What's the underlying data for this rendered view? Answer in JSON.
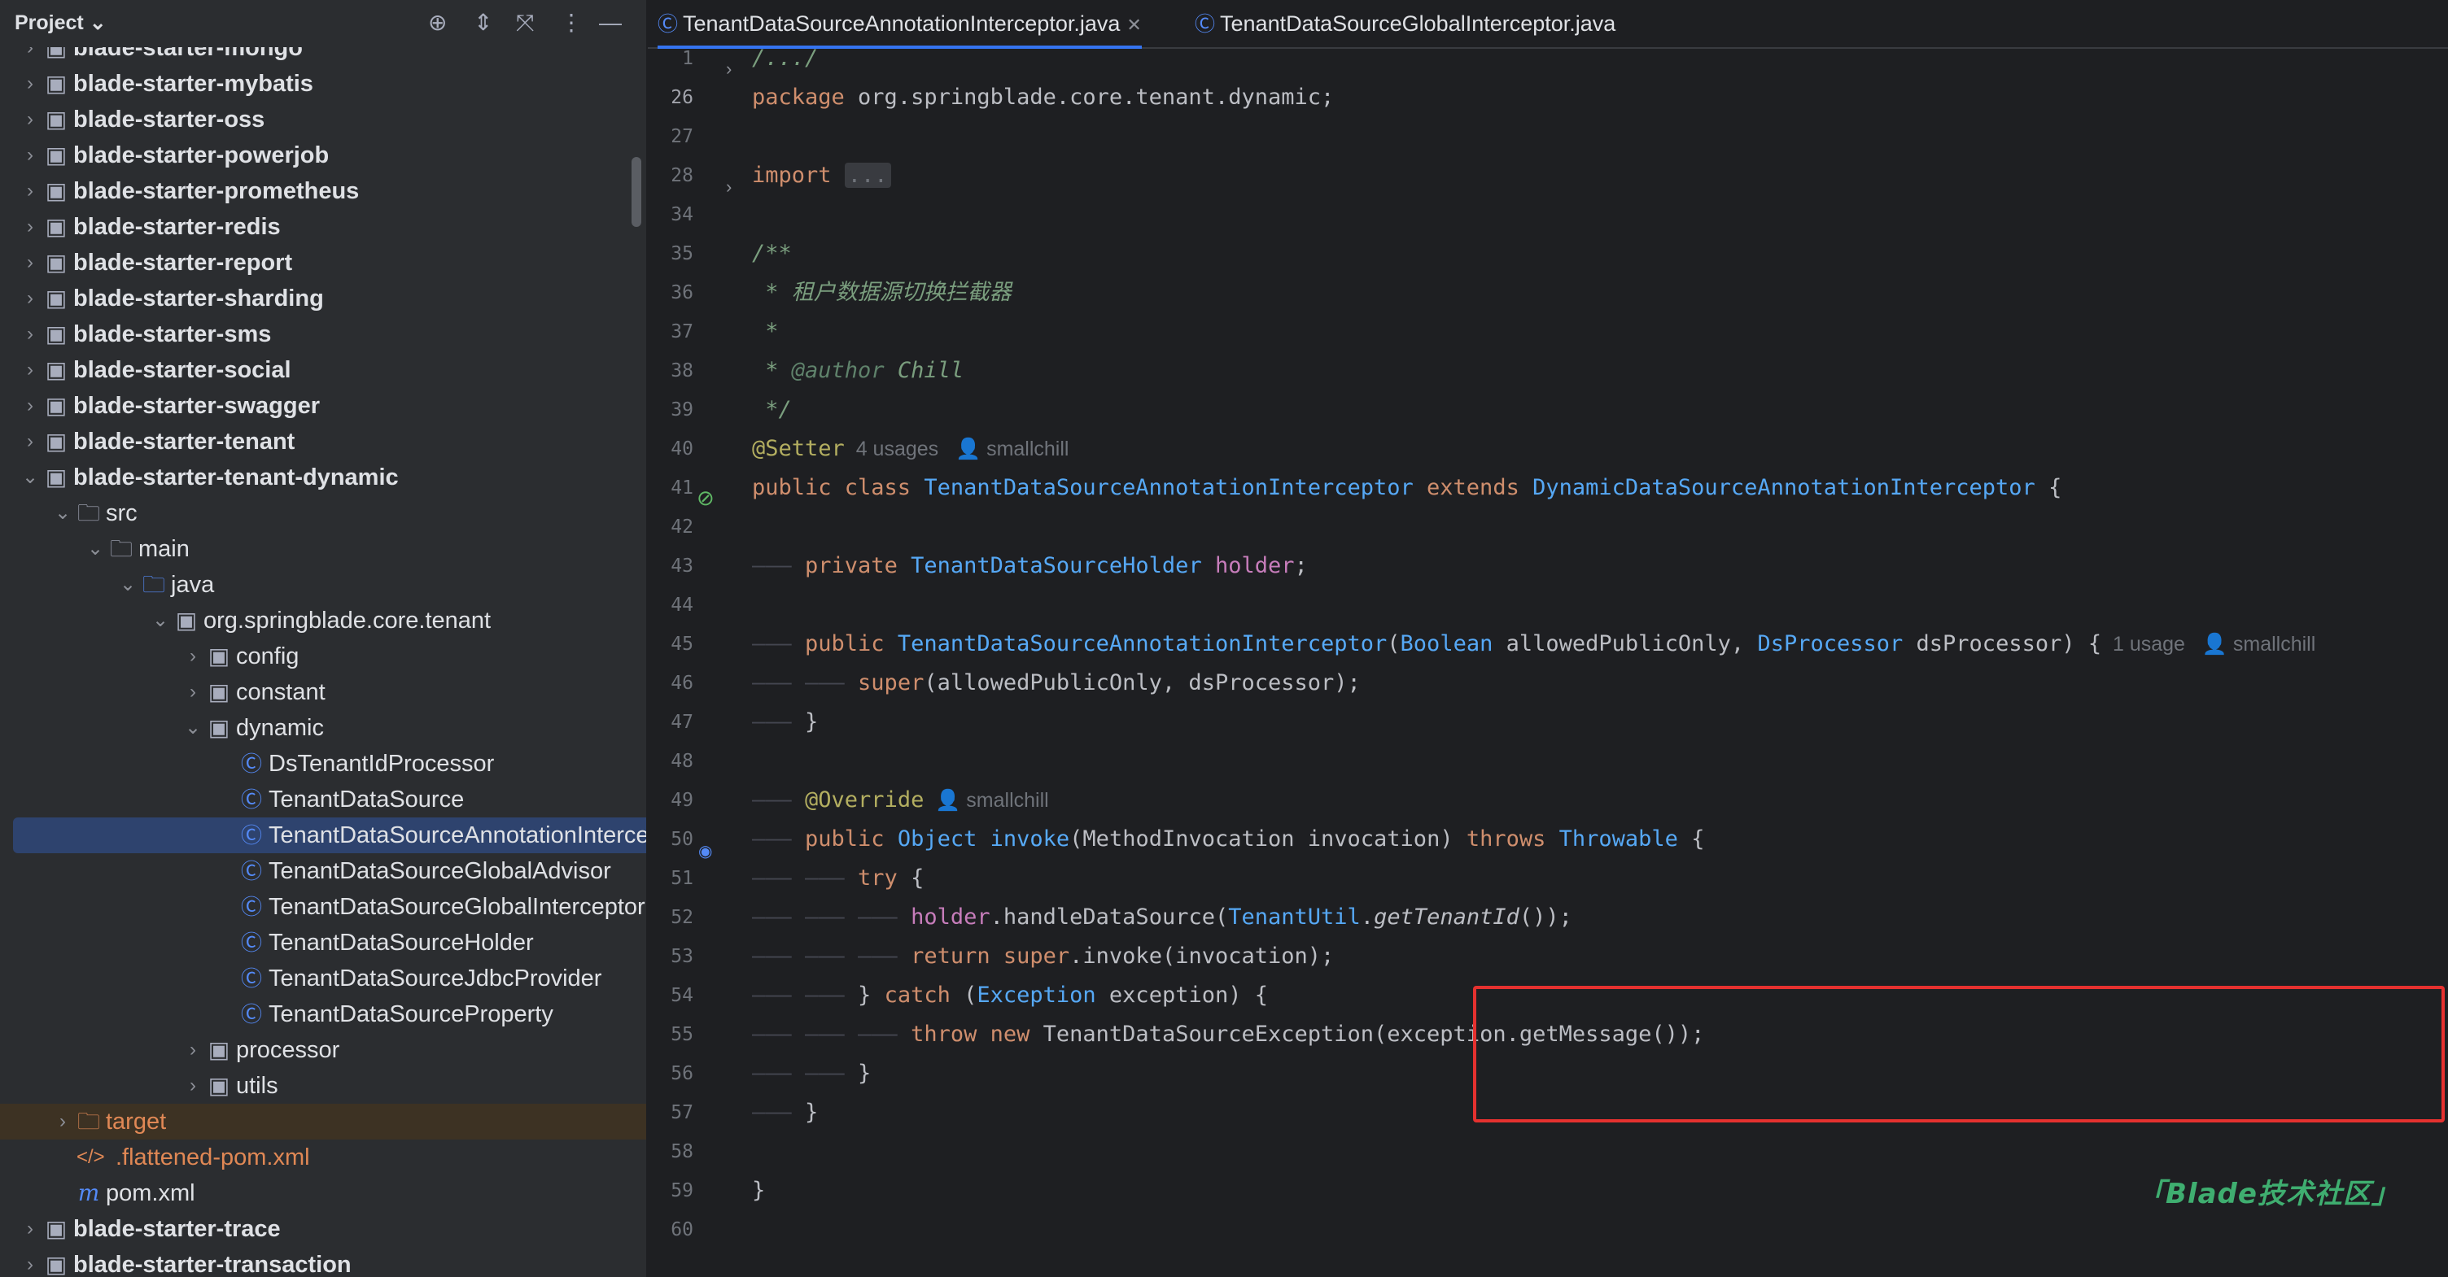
{
  "project_panel": {
    "title": "Project",
    "tree": [
      {
        "label": "blade-starter-mongo",
        "icon": "module-folder-icon",
        "kind": "module"
      },
      {
        "label": "blade-starter-mybatis",
        "icon": "module-folder-icon",
        "kind": "module"
      },
      {
        "label": "blade-starter-oss",
        "icon": "module-folder-icon",
        "kind": "module"
      },
      {
        "label": "blade-starter-powerjob",
        "icon": "module-folder-icon",
        "kind": "module"
      },
      {
        "label": "blade-starter-prometheus",
        "icon": "module-folder-icon",
        "kind": "module"
      },
      {
        "label": "blade-starter-redis",
        "icon": "module-folder-icon",
        "kind": "module"
      },
      {
        "label": "blade-starter-report",
        "icon": "module-folder-icon",
        "kind": "module"
      },
      {
        "label": "blade-starter-sharding",
        "icon": "module-folder-icon",
        "kind": "module"
      },
      {
        "label": "blade-starter-sms",
        "icon": "module-folder-icon",
        "kind": "module"
      },
      {
        "label": "blade-starter-social",
        "icon": "module-folder-icon",
        "kind": "module"
      },
      {
        "label": "blade-starter-swagger",
        "icon": "module-folder-icon",
        "kind": "module"
      },
      {
        "label": "blade-starter-tenant",
        "icon": "module-folder-icon",
        "kind": "module"
      },
      {
        "label": "blade-starter-tenant-dynamic",
        "icon": "module-folder-icon",
        "kind": "module",
        "expanded": true
      },
      {
        "label": "src",
        "icon": "folder-icon",
        "kind": "dir",
        "expanded": true
      },
      {
        "label": "main",
        "icon": "folder-icon",
        "kind": "dir",
        "expanded": true
      },
      {
        "label": "java",
        "icon": "source-folder-icon",
        "kind": "src",
        "expanded": true
      },
      {
        "label": "org.springblade.core.tenant",
        "icon": "package-icon",
        "kind": "pkg",
        "expanded": true
      },
      {
        "label": "config",
        "icon": "package-icon",
        "kind": "pkg"
      },
      {
        "label": "constant",
        "icon": "package-icon",
        "kind": "pkg"
      },
      {
        "label": "dynamic",
        "icon": "package-icon",
        "kind": "pkg",
        "expanded": true
      },
      {
        "label": "DsTenantIdProcessor",
        "icon": "class-icon",
        "kind": "cls"
      },
      {
        "label": "TenantDataSource",
        "icon": "class-icon",
        "kind": "cls"
      },
      {
        "label": "TenantDataSourceAnnotationInterceptor",
        "icon": "class-icon",
        "kind": "cls",
        "selected": true
      },
      {
        "label": "TenantDataSourceGlobalAdvisor",
        "icon": "class-icon",
        "kind": "cls"
      },
      {
        "label": "TenantDataSourceGlobalInterceptor",
        "icon": "class-icon",
        "kind": "cls"
      },
      {
        "label": "TenantDataSourceHolder",
        "icon": "class-icon",
        "kind": "cls"
      },
      {
        "label": "TenantDataSourceJdbcProvider",
        "icon": "class-icon",
        "kind": "cls"
      },
      {
        "label": "TenantDataSourceProperty",
        "icon": "class-icon",
        "kind": "cls"
      },
      {
        "label": "processor",
        "icon": "package-icon",
        "kind": "pkg"
      },
      {
        "label": "utils",
        "icon": "package-icon",
        "kind": "pkg"
      },
      {
        "label": "target",
        "icon": "folder-icon",
        "kind": "target"
      },
      {
        "label": ".flattened-pom.xml",
        "icon": "xml-file-icon",
        "kind": "xml"
      },
      {
        "label": "pom.xml",
        "icon": "maven-icon",
        "kind": "mvn"
      },
      {
        "label": "blade-starter-trace",
        "icon": "module-folder-icon",
        "kind": "module"
      },
      {
        "label": "blade-starter-transaction",
        "icon": "module-folder-icon",
        "kind": "module"
      }
    ]
  },
  "tabs": [
    {
      "label": "TenantDataSourceAnnotationInterceptor.java",
      "active": true
    },
    {
      "label": "TenantDataSourceGlobalInterceptor.java",
      "active": false
    }
  ],
  "editor": {
    "current_line": "26",
    "lines": [
      {
        "n": "1",
        "segs": [
          [
            "cm",
            "/.../"
          ]
        ]
      },
      {
        "n": "26",
        "segs": [
          [
            "kw",
            "package "
          ],
          [
            "",
            "org.springblade.core.tenant.dynamic;"
          ]
        ]
      },
      {
        "n": "27",
        "segs": []
      },
      {
        "n": "28",
        "segs": [
          [
            "kw",
            "import "
          ],
          [
            "fold",
            "..."
          ]
        ]
      },
      {
        "n": "34",
        "segs": []
      },
      {
        "n": "35",
        "segs": [
          [
            "cm",
            "/**"
          ]
        ]
      },
      {
        "n": "36",
        "segs": [
          [
            "cm",
            " * 租户数据源切换拦截器"
          ]
        ]
      },
      {
        "n": "37",
        "segs": [
          [
            "cm",
            " *"
          ]
        ]
      },
      {
        "n": "38",
        "segs": [
          [
            "cm",
            " * "
          ],
          [
            "cmc",
            "@author"
          ],
          [
            "cm",
            " Chill"
          ]
        ]
      },
      {
        "n": "39",
        "segs": [
          [
            "cm",
            " */"
          ]
        ]
      },
      {
        "n": "40",
        "segs": [
          [
            "ann",
            "@Setter"
          ],
          [
            "hint",
            "  4 usages   👤 smallchill"
          ]
        ]
      },
      {
        "n": "41",
        "segs": [
          [
            "kw",
            "public class "
          ],
          [
            "ty",
            "TenantDataSourceAnnotationInterceptor"
          ],
          [
            "kw",
            " extends "
          ],
          [
            "ty",
            "DynamicDataSourceAnnotationInterceptor"
          ],
          [
            "",
            " {"
          ]
        ]
      },
      {
        "n": "42",
        "segs": []
      },
      {
        "n": "43",
        "segs": [
          [
            "guide",
            "——— "
          ],
          [
            "kw",
            "private "
          ],
          [
            "ty",
            "TenantDataSourceHolder "
          ],
          [
            "fld",
            "holder"
          ],
          [
            "",
            ";"
          ]
        ]
      },
      {
        "n": "44",
        "segs": []
      },
      {
        "n": "45",
        "segs": [
          [
            "guide",
            "——— "
          ],
          [
            "kw",
            "public "
          ],
          [
            "mth",
            "TenantDataSourceAnnotationInterceptor"
          ],
          [
            "",
            "("
          ],
          [
            "ty",
            "Boolean "
          ],
          [
            "",
            "allowedPublicOnly, "
          ],
          [
            "ty",
            "DsProcessor "
          ],
          [
            "",
            "dsProcessor) {"
          ],
          [
            "hint",
            "  1 usage   👤 smallchill"
          ]
        ]
      },
      {
        "n": "46",
        "segs": [
          [
            "guide",
            "——— ——— "
          ],
          [
            "kw",
            "super"
          ],
          [
            "",
            "(allowedPublicOnly, dsProcessor);"
          ]
        ]
      },
      {
        "n": "47",
        "segs": [
          [
            "guide",
            "——— "
          ],
          [
            "",
            "}"
          ]
        ]
      },
      {
        "n": "48",
        "segs": []
      },
      {
        "n": "49",
        "segs": [
          [
            "guide",
            "——— "
          ],
          [
            "ann",
            "@Override"
          ],
          [
            "hint",
            "  👤 smallchill"
          ]
        ]
      },
      {
        "n": "50",
        "segs": [
          [
            "guide",
            "——— "
          ],
          [
            "kw",
            "public "
          ],
          [
            "ty",
            "Object "
          ],
          [
            "mth",
            "invoke"
          ],
          [
            "",
            "(MethodInvocation invocation) "
          ],
          [
            "kw",
            "throws "
          ],
          [
            "ty",
            "Throwable"
          ],
          [
            "",
            " {"
          ]
        ]
      },
      {
        "n": "51",
        "segs": [
          [
            "guide",
            "——— ——— "
          ],
          [
            "kw",
            "try"
          ],
          [
            "",
            " {"
          ]
        ]
      },
      {
        "n": "52",
        "segs": [
          [
            "guide",
            "——— ——— ——— "
          ],
          [
            "fld",
            "holder"
          ],
          [
            "",
            ".handleDataSource("
          ],
          [
            "ty",
            "TenantUtil"
          ],
          [
            "",
            "."
          ],
          [
            "stat",
            "getTenantId"
          ],
          [
            "",
            "());"
          ]
        ]
      },
      {
        "n": "53",
        "segs": [
          [
            "guide",
            "——— ——— ——— "
          ],
          [
            "kw",
            "return super"
          ],
          [
            "",
            ".invoke(invocation);"
          ]
        ]
      },
      {
        "n": "54",
        "segs": [
          [
            "guide",
            "——— ——— "
          ],
          [
            "",
            "} "
          ],
          [
            "kw",
            "catch"
          ],
          [
            "",
            " ("
          ],
          [
            "ty",
            "Exception "
          ],
          [
            "",
            "exception) {"
          ]
        ]
      },
      {
        "n": "55",
        "segs": [
          [
            "guide",
            "——— ——— ——— "
          ],
          [
            "kw",
            "throw new "
          ],
          [
            "",
            "TenantDataSourceException(exception.getMessage());"
          ]
        ]
      },
      {
        "n": "56",
        "segs": [
          [
            "guide",
            "——— ——— "
          ],
          [
            "",
            "}"
          ]
        ]
      },
      {
        "n": "57",
        "segs": [
          [
            "guide",
            "——— "
          ],
          [
            "",
            "}"
          ]
        ]
      },
      {
        "n": "58",
        "segs": []
      },
      {
        "n": "59",
        "segs": [
          [
            "",
            "}"
          ]
        ]
      },
      {
        "n": "60",
        "segs": []
      }
    ]
  },
  "watermark": "「Blade技术社区」",
  "colors": {
    "accent": "#3574f0",
    "highlight_box": "#e5312f",
    "selection": "#2e436e"
  }
}
